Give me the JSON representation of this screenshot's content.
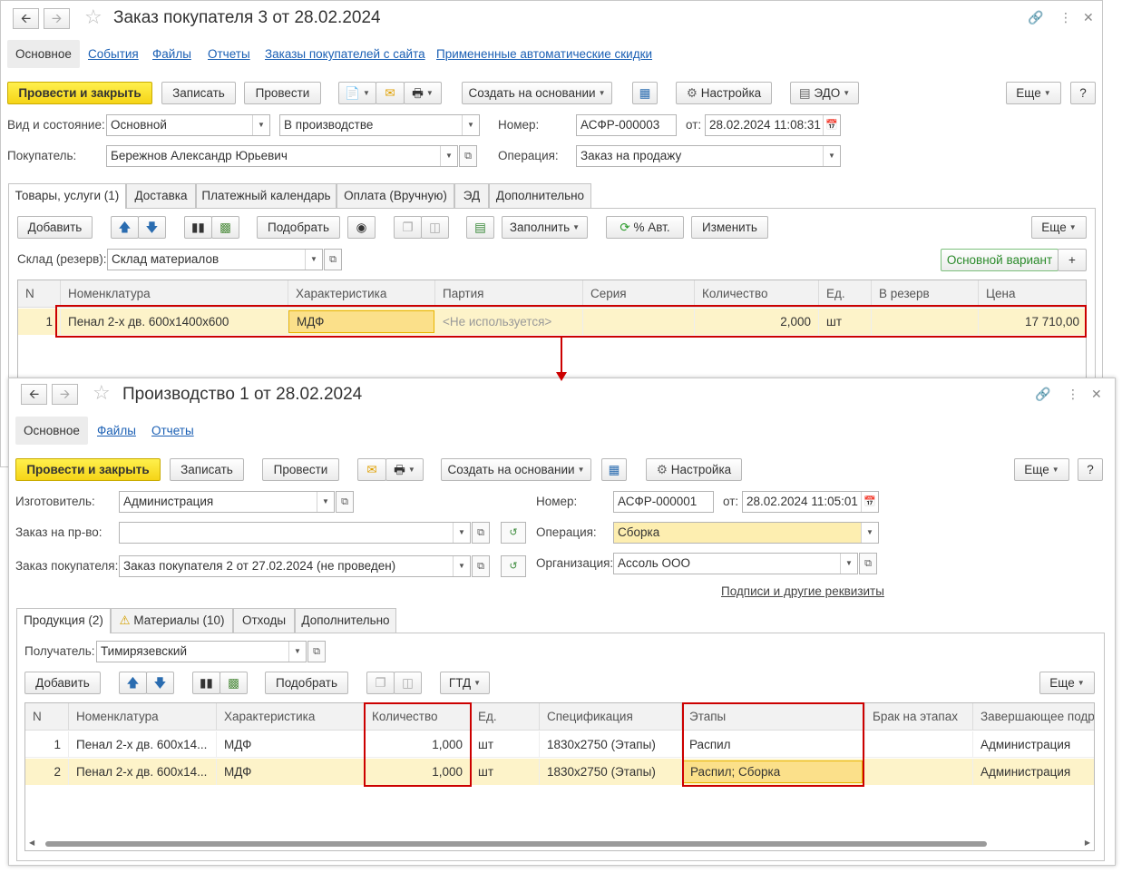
{
  "win1": {
    "title": "Заказ покупателя 3 от 28.02.2024",
    "tabs": [
      "Основное",
      "События",
      "Файлы",
      "Отчеты",
      "Заказы покупателей с сайта",
      "Примененные автоматические скидки"
    ],
    "toolbar": {
      "post_close": "Провести и закрыть",
      "save": "Записать",
      "post": "Провести",
      "create_based": "Создать на основании",
      "settings": "Настройка",
      "edo": "ЭДО",
      "more": "Еще",
      "help": "?"
    },
    "fields": {
      "kind_label": "Вид и состояние:",
      "kind_value": "Основной",
      "state_value": "В производстве",
      "number_label": "Номер:",
      "number_value": "АСФР-000003",
      "date_label": "от:",
      "date_value": "28.02.2024 11:08:31",
      "buyer_label": "Покупатель:",
      "buyer_value": "Бережнов Александр Юрьевич",
      "operation_label": "Операция:",
      "operation_value": "Заказ на продажу"
    },
    "inner_tabs": [
      "Товары, услуги (1)",
      "Доставка",
      "Платежный календарь",
      "Оплата (Вручную)",
      "ЭД",
      "Дополнительно"
    ],
    "inner_toolbar": {
      "add": "Добавить",
      "pick": "Подобрать",
      "fill": "Заполнить",
      "pct_auto": "% Авт.",
      "change": "Изменить",
      "more": "Еще"
    },
    "warehouse_label": "Склад (резерв):",
    "warehouse_value": "Склад материалов",
    "main_variant": "Основной вариант",
    "plus": "+",
    "table": {
      "headers": [
        "N",
        "Номенклатура",
        "Характеристика",
        "Партия",
        "Серия",
        "Количество",
        "Ед.",
        "В резерв",
        "Цена"
      ],
      "rows": [
        [
          "1",
          "Пенал 2-х дв. 600х1400х600",
          "МДФ",
          "<Не используется>",
          "",
          "2,000",
          "шт",
          "",
          "17 710,00"
        ]
      ]
    }
  },
  "win2": {
    "title": "Производство 1 от 28.02.2024",
    "tabs": [
      "Основное",
      "Файлы",
      "Отчеты"
    ],
    "toolbar": {
      "post_close": "Провести и закрыть",
      "save": "Записать",
      "post": "Провести",
      "create_based": "Создать на основании",
      "settings": "Настройка",
      "more": "Еще",
      "help": "?"
    },
    "fields": {
      "maker_label": "Изготовитель:",
      "maker_value": "Администрация",
      "order_prod_label": "Заказ на пр-во:",
      "order_prod_value": "",
      "buyer_order_label": "Заказ покупателя:",
      "buyer_order_value": "Заказ покупателя 2 от 27.02.2024 (не проведен)",
      "number_label": "Номер:",
      "number_value": "АСФР-000001",
      "date_label": "от:",
      "date_value": "28.02.2024 11:05:01",
      "operation_label": "Операция:",
      "operation_value": "Сборка",
      "org_label": "Организация:",
      "org_value": "Ассоль ООО",
      "signatures_link": "Подписи и другие реквизиты"
    },
    "inner_tabs": [
      "Продукция (2)",
      "Материалы (10)",
      "Отходы",
      "Дополнительно"
    ],
    "recipient_label": "Получатель:",
    "recipient_value": "Тимирязевский",
    "inner_toolbar": {
      "add": "Добавить",
      "pick": "Подобрать",
      "gtd": "ГТД",
      "more": "Еще"
    },
    "table": {
      "headers": [
        "N",
        "Номенклатура",
        "Характеристика",
        "Количество",
        "Ед.",
        "Спецификация",
        "Этапы",
        "Брак на этапах",
        "Завершающее подра"
      ],
      "rows": [
        [
          "1",
          "Пенал 2-х дв. 600х14...",
          "МДФ",
          "1,000",
          "шт",
          "1830х2750 (Этапы)",
          "Распил",
          "",
          "Администрация"
        ],
        [
          "2",
          "Пенал 2-х дв. 600х14...",
          "МДФ",
          "1,000",
          "шт",
          "1830х2750 (Этапы)",
          "Распил; Сборка",
          "",
          "Администрация"
        ]
      ]
    }
  },
  "colors": {
    "accent_yellow": "#f5d417",
    "row_highlight": "#fdf3c9",
    "callout_red": "#c00000",
    "link_blue": "#1a5fb4"
  }
}
